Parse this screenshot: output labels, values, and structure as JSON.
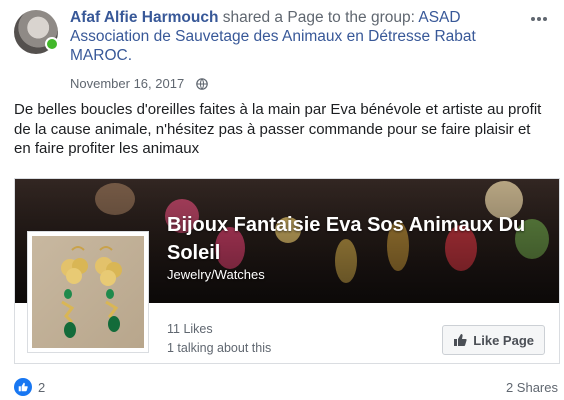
{
  "post": {
    "author": "Afaf Alfie Harmouch",
    "action": "shared a Page to the group:",
    "group": "ASAD Association de Sauvetage des Animaux en Détresse Rabat MAROC.",
    "date": "November 16, 2017",
    "body": "De belles boucles d'oreilles faites à la main par Eva bénévole et artiste au profit de la cause animale, n'hésitez pas à passer commande pour se faire plaisir et en faire profiter les animaux"
  },
  "page_card": {
    "title": "Bijoux Fantaisie Eva Sos Animaux Du Soleil",
    "category": "Jewelry/Watches",
    "likes": "11 Likes",
    "talking": "1 talking about this",
    "like_button_label": "Like Page"
  },
  "footer": {
    "reaction_count": "2",
    "shares": "2 Shares"
  },
  "colors": {
    "link_blue": "#385898",
    "online_green": "#42b72a",
    "reaction_blue": "#1877f2"
  },
  "icons": [
    "globe-icon",
    "more-options-icon",
    "thumbs-up-icon",
    "like-reaction-icon"
  ]
}
